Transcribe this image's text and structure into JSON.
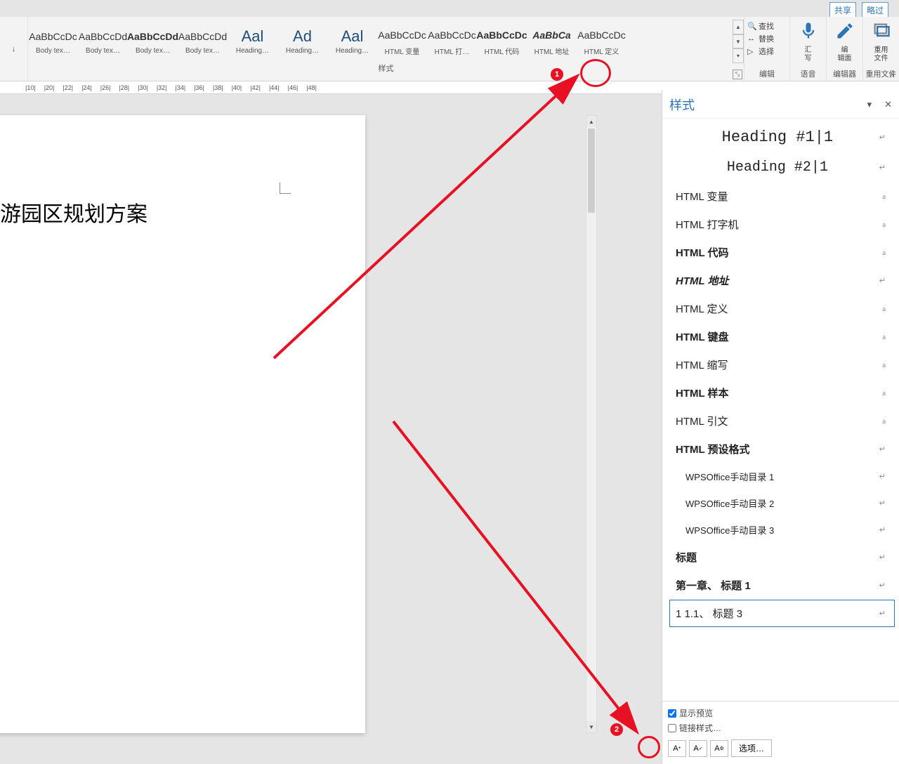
{
  "top_buttons": {
    "share": "共享",
    "more": "略过"
  },
  "ribbon": {
    "clipboard": "↓",
    "gallery": [
      {
        "prev": "AaBbCcDc",
        "name": "Body tex…",
        "cls": ""
      },
      {
        "prev": "AaBbCcDd",
        "name": "Body tex…",
        "cls": ""
      },
      {
        "prev": "AaBbCcDd",
        "name": "Body tex…",
        "cls": "bold"
      },
      {
        "prev": "AaBbCcDd",
        "name": "Body tex…",
        "cls": ""
      },
      {
        "prev": "Aal",
        "name": "Heading…",
        "cls": "big"
      },
      {
        "prev": "Ad",
        "name": "Heading…",
        "cls": "big"
      },
      {
        "prev": "Aal",
        "name": "Heading…",
        "cls": "big"
      },
      {
        "prev": "AaBbCcDc",
        "name": "HTML 变量",
        "cls": ""
      },
      {
        "prev": "AaBbCcDc",
        "name": "HTML 打…",
        "cls": ""
      },
      {
        "prev": "AaBbCcDc",
        "name": "HTML 代码",
        "cls": "bold"
      },
      {
        "prev": "AaBbCa",
        "name": "HTML 地址",
        "cls": "italic"
      },
      {
        "prev": "AaBbCcDc",
        "name": "HTML 定义",
        "cls": ""
      }
    ],
    "gallery_label": "样式",
    "edit": {
      "find": "查找",
      "replace": "替换",
      "select": "选择",
      "label": "编辑"
    },
    "voice": {
      "name": "汇\n写",
      "label": "语音"
    },
    "editor": {
      "name": "编\n辑面",
      "label": "编辑器"
    },
    "reuse": {
      "name": "重用\n文件",
      "label": "重用文件"
    }
  },
  "ruler_ticks": [
    "|10|",
    "|20|",
    "|22|",
    "|24|",
    "|26|",
    "|28|",
    "|30|",
    "|32|",
    "|34|",
    "|36|",
    "|38|",
    "|40|",
    "|42|",
    "|44|",
    "|46|",
    "|48|"
  ],
  "document": {
    "title": "游园区规划方案"
  },
  "pane": {
    "title": "样式",
    "items": [
      {
        "text": "Heading #1|1",
        "mark": "↵",
        "cls": "h1"
      },
      {
        "text": "Heading #2|1",
        "mark": "↵",
        "cls": "h2"
      },
      {
        "text": "HTML 变量",
        "mark": "a",
        "cls": ""
      },
      {
        "text": "HTML 打字机",
        "mark": "a",
        "cls": ""
      },
      {
        "text": "HTML 代码",
        "mark": "a",
        "cls": "bold"
      },
      {
        "text": "HTML 地址",
        "mark": "↵",
        "cls": "italic"
      },
      {
        "text": "HTML 定义",
        "mark": "a",
        "cls": ""
      },
      {
        "text": "HTML 键盘",
        "mark": "a",
        "cls": "bold"
      },
      {
        "text": "HTML 缩写",
        "mark": "a",
        "cls": ""
      },
      {
        "text": "HTML 样本",
        "mark": "a",
        "cls": "bold"
      },
      {
        "text": "HTML 引文",
        "mark": "a",
        "cls": ""
      },
      {
        "text": "HTML 预设格式",
        "mark": "↵",
        "cls": "bold"
      },
      {
        "text": "WPSOffice手动目录 1",
        "mark": "↵",
        "cls": "indent"
      },
      {
        "text": "WPSOffice手动目录 2",
        "mark": "↵",
        "cls": "indent"
      },
      {
        "text": "WPSOffice手动目录 3",
        "mark": "↵",
        "cls": "indent"
      },
      {
        "text": "标题",
        "mark": "↵",
        "cls": "bold"
      },
      {
        "text": "第一章、 标题 1",
        "mark": "↵",
        "cls": "bold"
      },
      {
        "text": "1 1.1、 标题 3",
        "mark": "↵",
        "cls": "sel"
      }
    ],
    "show_preview": "显示预览",
    "link_check": "链接样式…",
    "options": "选项…"
  },
  "annotations": {
    "badge1": "1",
    "badge2": "2"
  }
}
